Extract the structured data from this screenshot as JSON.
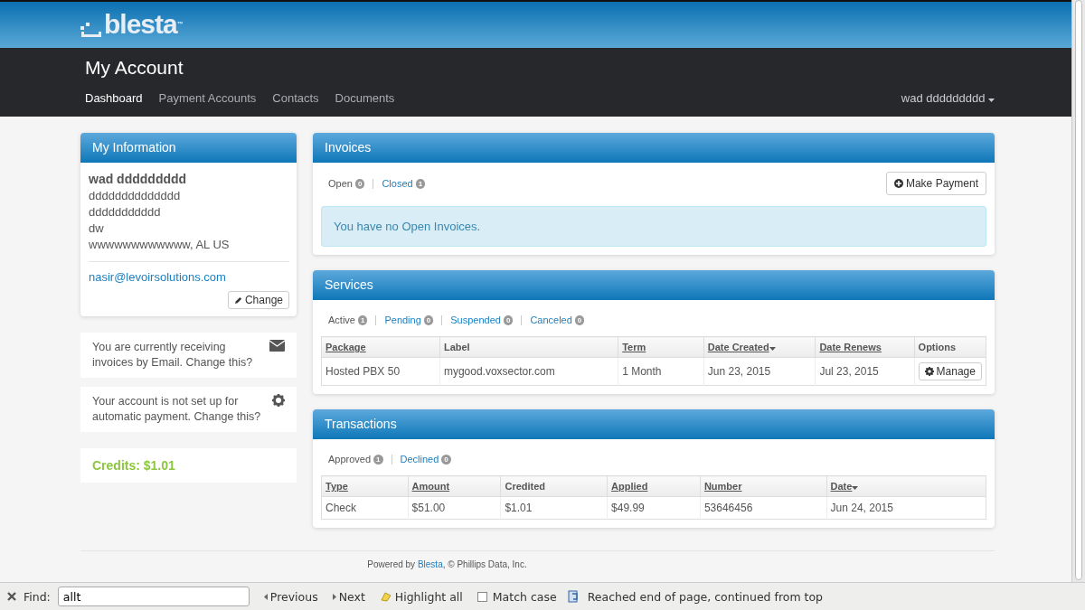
{
  "header": {
    "logo": "blesta",
    "logo_mark": "™",
    "title": "My Account",
    "nav": [
      {
        "label": "Dashboard",
        "selected": true
      },
      {
        "label": "Payment Accounts",
        "selected": false
      },
      {
        "label": "Contacts",
        "selected": false
      },
      {
        "label": "Documents",
        "selected": false
      }
    ],
    "user_menu": "wad ddddddddd"
  },
  "my_information": {
    "title": "My Information",
    "name": "wad ddddddddd",
    "address_lines": [
      "dddddddddddddd",
      "ddddddddddd",
      "dw",
      "wwwwwwwwwwww, AL US"
    ],
    "email": "nasir@levoirsolutions.com",
    "change_button": "Change"
  },
  "notices": [
    {
      "kind": "email",
      "text": "You are currently receiving invoices by Email. Change this?"
    },
    {
      "kind": "gear",
      "text": "Your account is not set up for automatic payment. Change this?"
    }
  ],
  "credits": "Credits: $1.01",
  "invoices": {
    "title": "Invoices",
    "filters": [
      {
        "label": "Open",
        "count": "0",
        "selected": true
      },
      {
        "label": "Closed",
        "count": "1",
        "selected": false
      }
    ],
    "make_payment": "Make Payment",
    "message": "You have no Open Invoices."
  },
  "services": {
    "title": "Services",
    "filters": [
      {
        "label": "Active",
        "count": "1",
        "selected": true
      },
      {
        "label": "Pending",
        "count": "0",
        "selected": false
      },
      {
        "label": "Suspended",
        "count": "0",
        "selected": false
      },
      {
        "label": "Canceled",
        "count": "0",
        "selected": false
      }
    ],
    "columns": [
      {
        "label": "Package",
        "sortable": true,
        "sorted": false
      },
      {
        "label": "Label",
        "sortable": false,
        "sorted": false
      },
      {
        "label": "Term",
        "sortable": true,
        "sorted": false
      },
      {
        "label": "Date Created",
        "sortable": true,
        "sorted": true
      },
      {
        "label": "Date Renews",
        "sortable": true,
        "sorted": false
      },
      {
        "label": "Options",
        "sortable": false,
        "sorted": false
      }
    ],
    "rows": [
      {
        "cells": [
          "Hosted PBX 50",
          "mygood.voxsector.com",
          "1 Month",
          "Jun 23, 2015",
          "Jul 23, 2015"
        ],
        "button": "Manage"
      }
    ]
  },
  "transactions": {
    "title": "Transactions",
    "filters": [
      {
        "label": "Approved",
        "count": "1",
        "selected": true
      },
      {
        "label": "Declined",
        "count": "0",
        "selected": false
      }
    ],
    "columns": [
      {
        "label": "Type",
        "sortable": true,
        "sorted": false
      },
      {
        "label": "Amount",
        "sortable": true,
        "sorted": false
      },
      {
        "label": "Credited",
        "sortable": false,
        "sorted": false
      },
      {
        "label": "Applied",
        "sortable": true,
        "sorted": false
      },
      {
        "label": "Number",
        "sortable": true,
        "sorted": false
      },
      {
        "label": "Date",
        "sortable": true,
        "sorted": true
      }
    ],
    "rows": [
      {
        "cells": [
          "Check",
          "$51.00",
          "$1.01",
          "$49.99",
          "53646456",
          "Jun 24, 2015"
        ]
      }
    ]
  },
  "footer": {
    "prefix": "Powered by",
    "link": "Blesta",
    "suffix": ", © Phillips Data, Inc."
  },
  "find_bar": {
    "label": "Find:",
    "value": "allt",
    "previous": "Previous",
    "next": "Next",
    "highlight_all": "Highlight all",
    "match_case": {
      "label": "Match case",
      "checked": false
    },
    "status": "Reached end of page, continued from top"
  }
}
